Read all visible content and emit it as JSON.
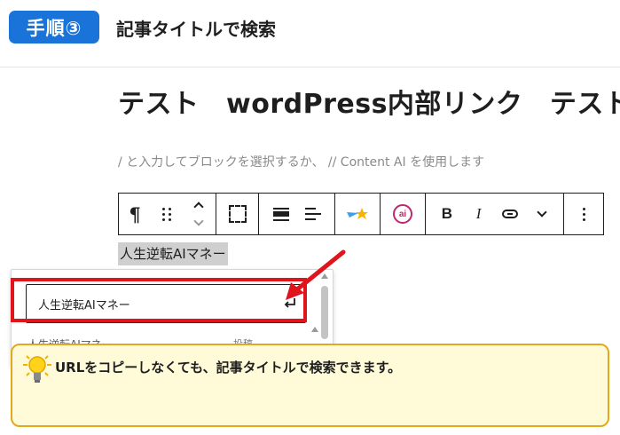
{
  "step": {
    "badge": "手順③",
    "title": "記事タイトルで検索"
  },
  "editor": {
    "post_title": "テスト　wordPress内部リンク　テスト",
    "placeholder": "/ と入力してブロックを選択するか、 // Content AI を使用します",
    "selected_text": "人生逆転AIマネー"
  },
  "toolbar": {
    "paragraph_glyph": "¶",
    "ai_badge": "ai",
    "bold_label": "B",
    "italic_label": "I"
  },
  "link_popover": {
    "search_value": "人生逆転AIマネー",
    "result_peek_title": "人生逆転AIマネー",
    "result_peek_meta": "投稿"
  },
  "tip": {
    "text": "URLをコピーしなくても、記事タイトルで検索できます。"
  },
  "colors": {
    "badge_bg": "#1a73d9",
    "highlight_red": "#e0141c",
    "tip_bg": "#fffbd9",
    "tip_border": "#e3a81b",
    "ai_accent": "#c0266f"
  }
}
